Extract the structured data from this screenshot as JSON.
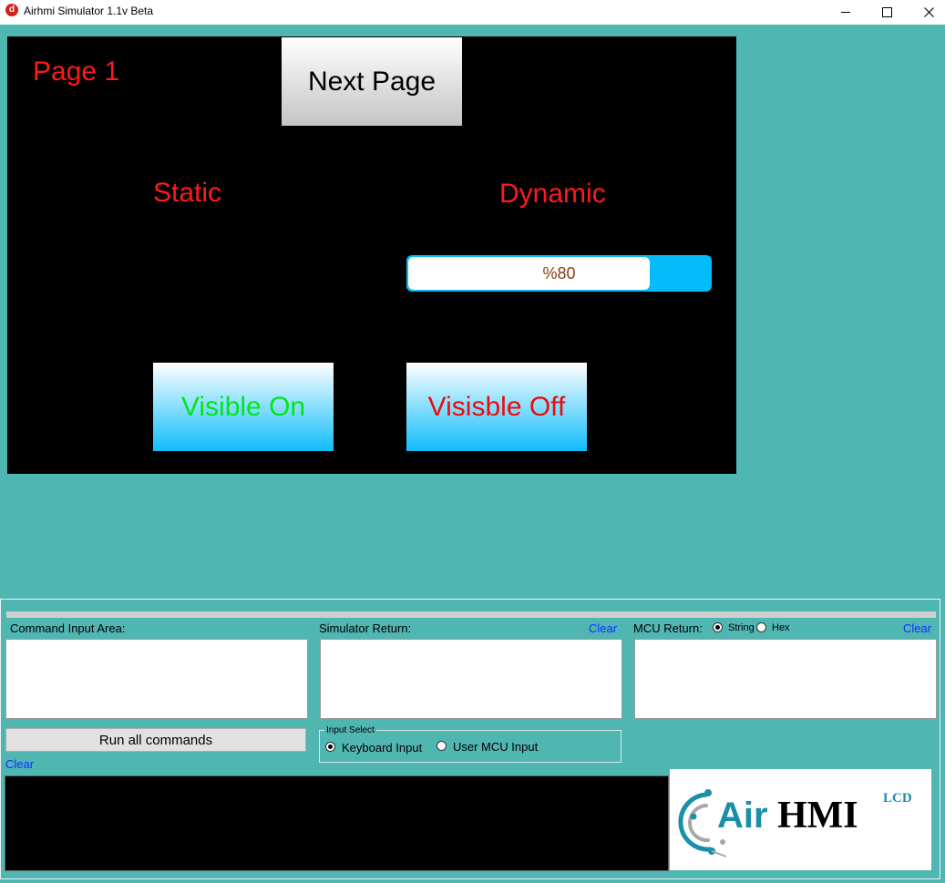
{
  "window": {
    "icon_letter": "d",
    "title": "Airhmi Simulator 1.1v Beta"
  },
  "hmi": {
    "page_title": "Page 1",
    "next_button": "Next Page",
    "static_label": "Static",
    "dynamic_label": "Dynamic",
    "progress": {
      "value": 80,
      "text": "%80"
    },
    "visible_on_button": "Visible On",
    "visible_off_button": "Visisble Off"
  },
  "panel": {
    "command_input_label": "Command Input Area:",
    "command_input_value": "",
    "simulator_return_label": "Simulator Return:",
    "simulator_return_value": "",
    "simulator_clear": "Clear",
    "mcu_return_label": "MCU Return:",
    "mcu_return_value": "",
    "mcu_format_options": [
      {
        "label": "String",
        "selected": true
      },
      {
        "label": "Hex",
        "selected": false
      }
    ],
    "mcu_clear": "Clear",
    "run_button": "Run all commands",
    "input_select_title": "Input Select",
    "input_select_options": [
      {
        "label": "Keyboard Input",
        "selected": true
      },
      {
        "label": "User MCU Input",
        "selected": false
      }
    ],
    "console_clear": "Clear"
  },
  "logo": {
    "text_air": "Air",
    "text_hmi": "HMI",
    "text_lcd": "LCD"
  },
  "colors": {
    "background": "#4fb6b2",
    "hmi_text_red": "#ff1a1a",
    "visible_on_green": "#00e61a",
    "progress_blue": "#06bcf8",
    "link_blue": "#1030ff",
    "logo_teal": "#1a8fa8"
  }
}
